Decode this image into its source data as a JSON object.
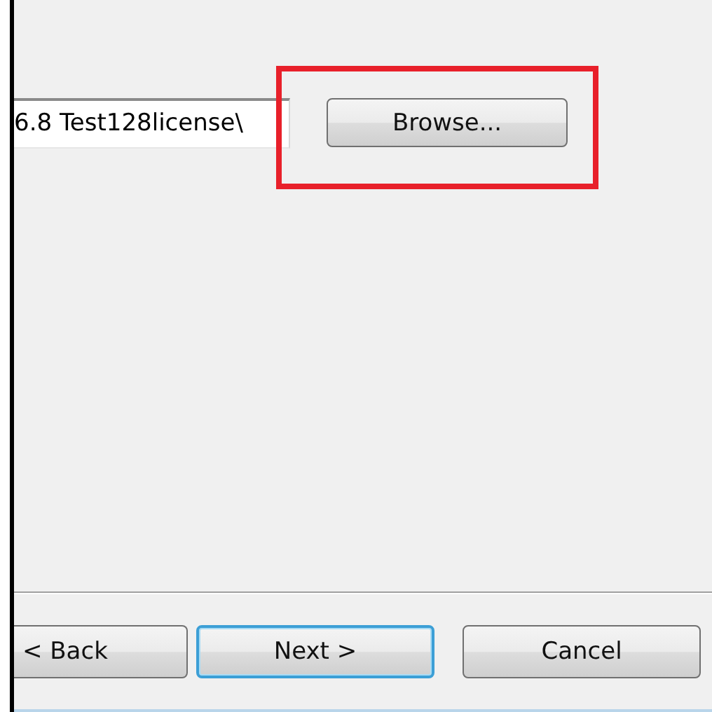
{
  "path_field": {
    "value": "6.8 Test128license\\"
  },
  "browse_button": {
    "label": "Browse..."
  },
  "annotation": {
    "kind": "rectangle",
    "color": "#e8202a"
  },
  "buttons": [
    {
      "label": "< Back",
      "focused": false
    },
    {
      "label": "Next >",
      "focused": true
    },
    {
      "label": "Cancel",
      "focused": false
    }
  ]
}
